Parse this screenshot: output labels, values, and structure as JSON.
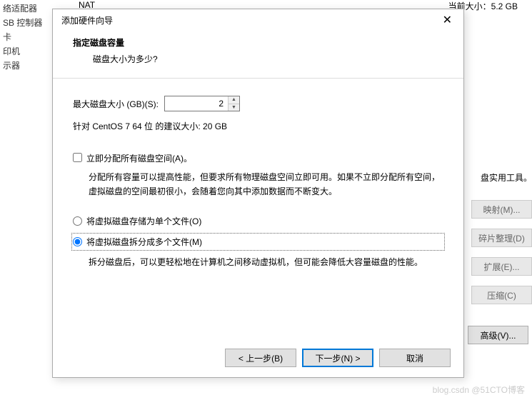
{
  "background": {
    "left_items": [
      "络适配器",
      "SB 控制器",
      "卡",
      "印机",
      "示器"
    ],
    "nat": "NAT",
    "current_size": "当前大小：5.2 GB",
    "disk_tools": "盘实用工具。",
    "right_buttons": [
      "映射(M)...",
      "碎片整理(D)",
      "扩展(E)...",
      "压缩(C)"
    ],
    "advanced": "高级(V)..."
  },
  "dialog": {
    "title": "添加硬件向导",
    "heading": "指定磁盘容量",
    "subheading": "磁盘大小为多少?",
    "size_label": "最大磁盘大小 (GB)(S):",
    "size_value": "2",
    "recommended": "针对 CentOS 7 64 位 的建议大小: 20 GB",
    "allocate_now": "立即分配所有磁盘空间(A)。",
    "allocate_desc": "分配所有容量可以提高性能，但要求所有物理磁盘空间立即可用。如果不立即分配所有空间，虚拟磁盘的空间最初很小，会随着您向其中添加数据而不断变大。",
    "radio_single": "将虚拟磁盘存储为单个文件(O)",
    "radio_split": "将虚拟磁盘拆分成多个文件(M)",
    "split_desc": "拆分磁盘后，可以更轻松地在计算机之间移动虚拟机，但可能会降低大容量磁盘的性能。",
    "back": "< 上一步(B)",
    "next": "下一步(N) >",
    "cancel": "取消"
  },
  "watermark": "blog.csdn @51CTO博客"
}
